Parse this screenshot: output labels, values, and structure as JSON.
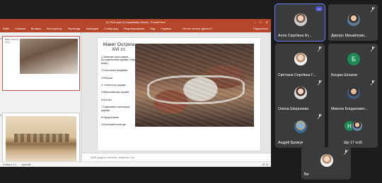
{
  "ppt": {
    "window_title": "(1) РАИ.pptx [Compatibility Mode] - PowerPoint",
    "ribbon_tabs": [
      "Файл",
      "Главная",
      "Вставка",
      "Конструктор",
      "Переходы",
      "Анимация",
      "Слайд-шоу",
      "Рецензирование",
      "Вид",
      "Справка"
    ],
    "tell_me": "Что вы хотите сделать?",
    "share": "Поделиться",
    "slide": {
      "title": "Макет Острога XVI ст.",
      "items": [
        "1.Замкова гора (замок, Богоявленська церква, Нова вежа)",
        "2.Острозька академія",
        "3.Ратуша",
        "4. Успенська церква",
        "5.Миколаївська церква",
        "6.Костел",
        "7.Параскево-пятницька церква",
        "8.Луцька вежа",
        "9.Ерітський колегіум"
      ]
    },
    "thumbnails": [
      {
        "number": "1",
        "mini_title": "Макет Острога XVI ст."
      },
      {
        "number": "2"
      }
    ],
    "notes_placeholder": "Щоб додати нотатки, клацніть тут",
    "status": {
      "slide": "Слайд 1 з 2",
      "lang": "русский",
      "zoom": "57 %"
    }
  },
  "participants": [
    {
      "name": "Алла Сергіївна Ат...",
      "avatar": "photo",
      "active": true
    },
    {
      "name": "Дмитро Михайлови...",
      "avatar": "photo"
    },
    {
      "name": "Світлана Сергіївна Г...",
      "avatar": "photo"
    },
    {
      "name": "Богдан Шлахов",
      "avatar_letter": "Б"
    },
    {
      "name": "Олена Шершнева",
      "avatar": "photo"
    },
    {
      "name": "Микола Богданович...",
      "avatar": "photo"
    },
    {
      "name": "Андрій Брижук",
      "avatar": "photo"
    },
    {
      "name": "Ще 17 осіб",
      "avatar_letter": "Н"
    },
    {
      "name": "Ви",
      "avatar": "photo"
    }
  ],
  "colors": {
    "ppt_accent": "#b7472a",
    "tile_bg": "#3b3b3b",
    "app_bg": "#1c1c1c",
    "active_outline": "#6a7cff"
  }
}
